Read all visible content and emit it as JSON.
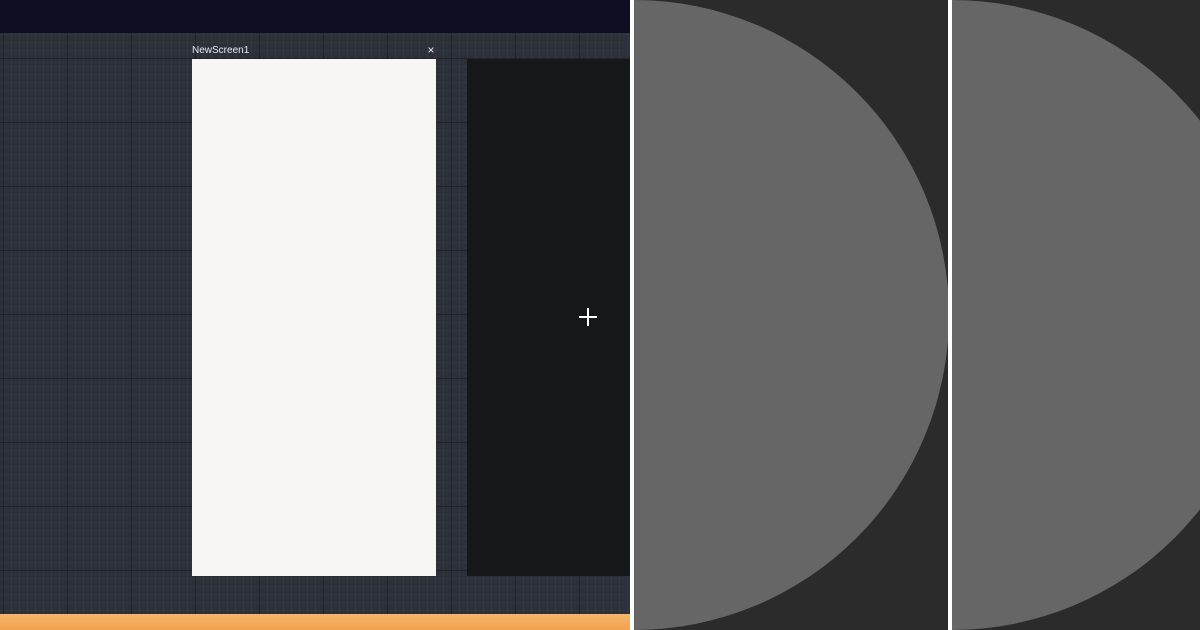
{
  "screen": {
    "title": "NewScreen1",
    "close_label": "×"
  },
  "add_screen": {
    "icon": "plus-icon"
  },
  "colors": {
    "topbar": "#0d0e1f",
    "canvas": "#2b3039",
    "screen_background": "#f7f6f3",
    "add_screen_background": "#161718",
    "bottombar": "#f3a24f",
    "panel_background": "#2b2b2b",
    "circle": "#666666",
    "divider": "#ffffff"
  }
}
